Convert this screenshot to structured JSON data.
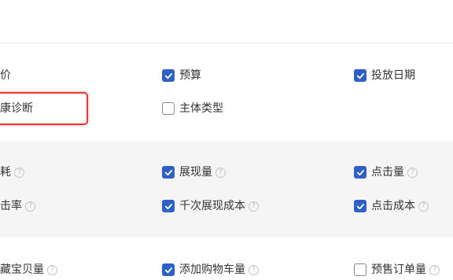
{
  "basic": {
    "items": [
      {
        "label": "价",
        "checked": null
      },
      {
        "label": "预算",
        "checked": true
      },
      {
        "label": "投放日期",
        "checked": true
      },
      {
        "label": "康诊断",
        "checked": null
      },
      {
        "label": "主体类型",
        "checked": false
      }
    ]
  },
  "performance": {
    "items": [
      {
        "label": "耗",
        "checked": null,
        "help": "?"
      },
      {
        "label": "展现量",
        "checked": true,
        "help": "?"
      },
      {
        "label": "点击量",
        "checked": true,
        "help": "?"
      },
      {
        "label": "击率",
        "checked": null,
        "help": "?"
      },
      {
        "label": "千次展现成本",
        "checked": true,
        "help": "?"
      },
      {
        "label": "点击成本",
        "checked": true,
        "help": "?"
      }
    ]
  },
  "conversion": {
    "items": [
      {
        "label": "藏宝贝量",
        "checked": null,
        "help": "?"
      },
      {
        "label": "添加购物车量",
        "checked": true,
        "help": "?"
      },
      {
        "label": "预售订单量",
        "checked": false,
        "help": "?"
      }
    ]
  },
  "colors": {
    "checkbox_accent": "#2d61c8",
    "highlight_border": "#e53935",
    "section_alt_bg": "#f5f5f5"
  }
}
